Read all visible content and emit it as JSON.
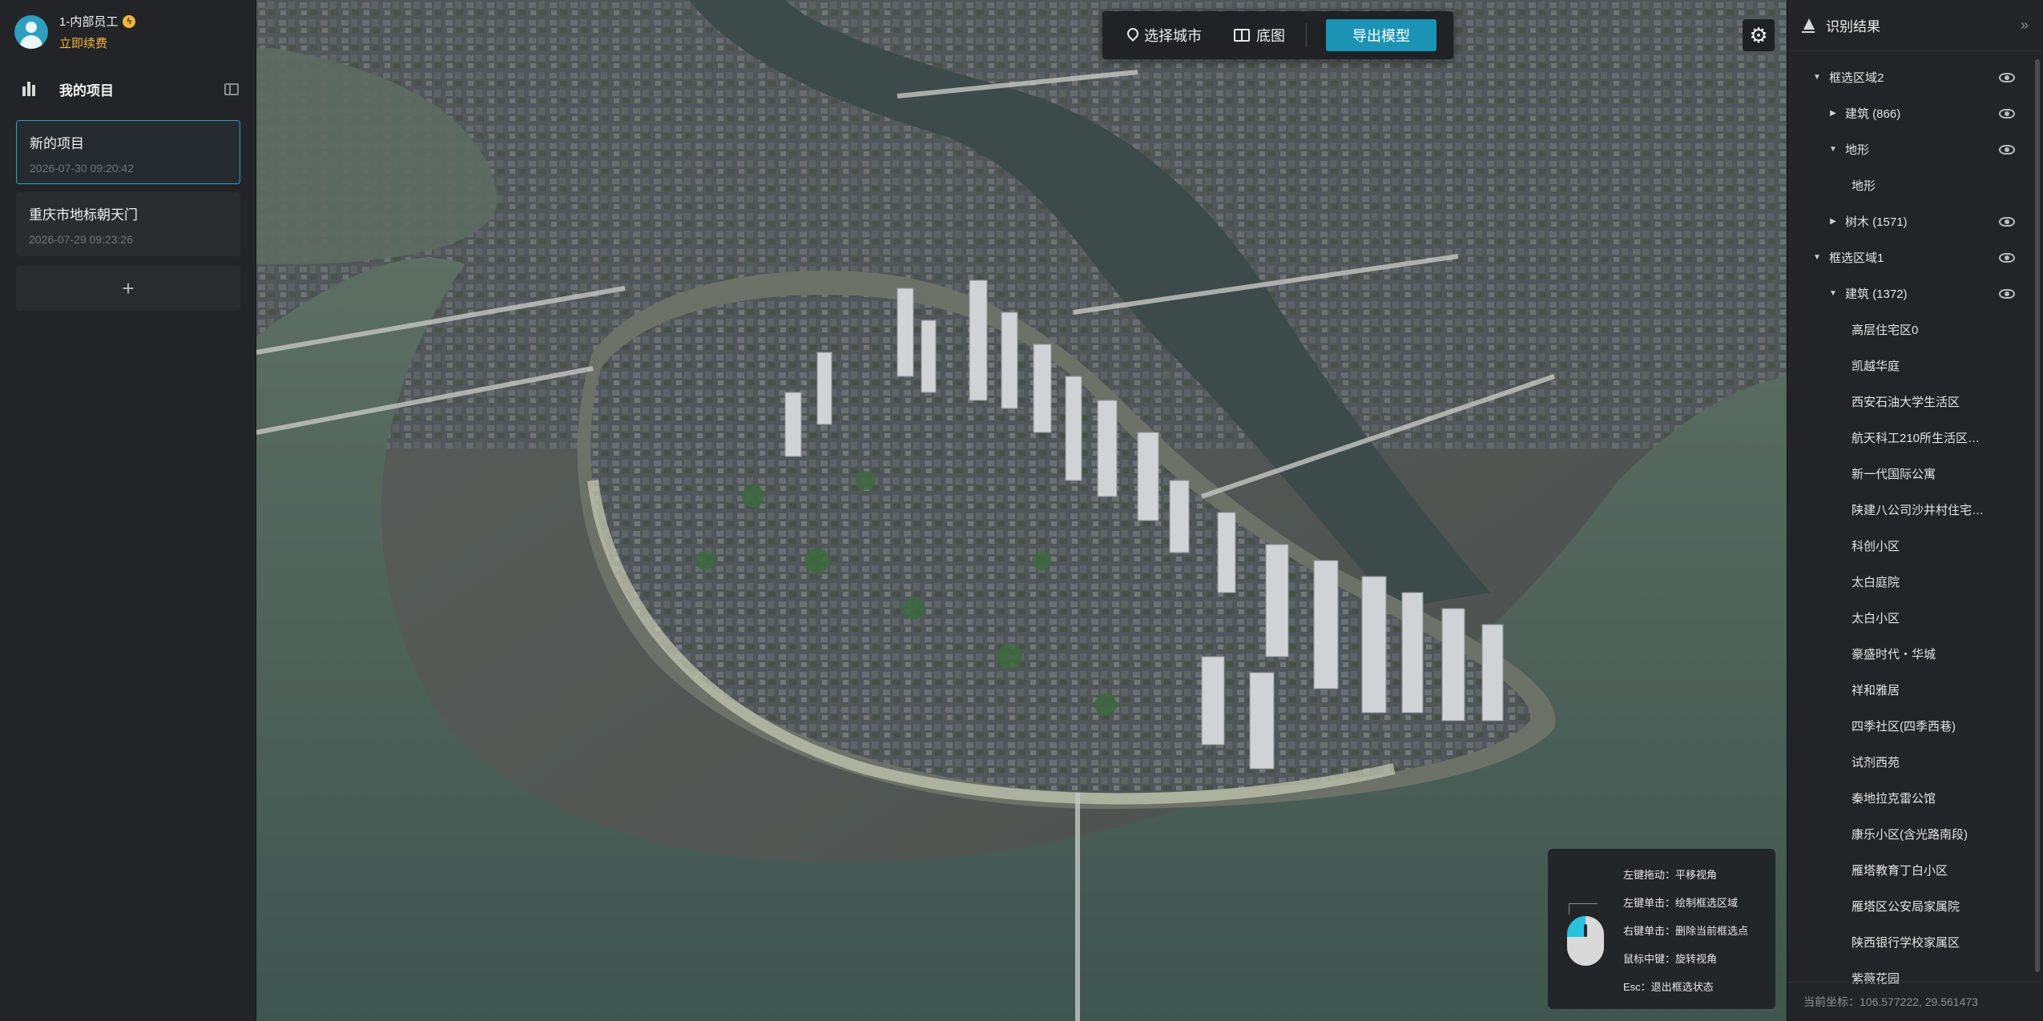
{
  "user": {
    "name": "1-内部员工",
    "renew": "立即续费"
  },
  "projects": {
    "title": "我的项目",
    "items": [
      {
        "name": "新的项目",
        "date": "2026-07-30 09:20:42"
      },
      {
        "name": "重庆市地标朝天门",
        "date": "2026-07-29 09:23:26"
      }
    ],
    "add_label": "+"
  },
  "toolbar": {
    "city_label": "选择城市",
    "basemap_label": "底图",
    "export_label": "导出模型"
  },
  "hints": [
    "左键拖动：平移视角",
    "左键单击：绘制框选区域",
    "右键单击：删除当前框选点",
    "鼠标中键：旋转视角",
    "Esc：退出框选状态"
  ],
  "results": {
    "title": "识别结果",
    "tree": [
      {
        "label": "框选区域2",
        "level": 0,
        "caret": "down",
        "eye": true
      },
      {
        "label": "建筑 (866)",
        "level": 1,
        "caret": "right",
        "eye": true
      },
      {
        "label": "地形",
        "level": 1,
        "caret": "down",
        "eye": true
      },
      {
        "label": "地形",
        "level": 2,
        "caret": "",
        "eye": false
      },
      {
        "label": "树木 (1571)",
        "level": 1,
        "caret": "right",
        "eye": true
      },
      {
        "label": "框选区域1",
        "level": 0,
        "caret": "down",
        "eye": true
      },
      {
        "label": "建筑 (1372)",
        "level": 1,
        "caret": "down",
        "eye": true
      },
      {
        "label": "高层住宅区0",
        "level": 2,
        "caret": "",
        "eye": false
      },
      {
        "label": "凯越华庭",
        "level": 2,
        "caret": "",
        "eye": false
      },
      {
        "label": "西安石油大学生活区",
        "level": 2,
        "caret": "",
        "eye": false
      },
      {
        "label": "航天科工210所生活区…",
        "level": 2,
        "caret": "",
        "eye": false
      },
      {
        "label": "新一代国际公寓",
        "level": 2,
        "caret": "",
        "eye": false
      },
      {
        "label": "陕建八公司沙井村住宅…",
        "level": 2,
        "caret": "",
        "eye": false
      },
      {
        "label": "科创小区",
        "level": 2,
        "caret": "",
        "eye": false
      },
      {
        "label": "太白庭院",
        "level": 2,
        "caret": "",
        "eye": false
      },
      {
        "label": "太白小区",
        "level": 2,
        "caret": "",
        "eye": false
      },
      {
        "label": "豪盛时代・华城",
        "level": 2,
        "caret": "",
        "eye": false
      },
      {
        "label": "祥和雅居",
        "level": 2,
        "caret": "",
        "eye": false
      },
      {
        "label": "四季社区(四季西巷)",
        "level": 2,
        "caret": "",
        "eye": false
      },
      {
        "label": "试剂西苑",
        "level": 2,
        "caret": "",
        "eye": false
      },
      {
        "label": "秦地拉克雷公馆",
        "level": 2,
        "caret": "",
        "eye": false
      },
      {
        "label": "康乐小区(含光路南段)",
        "level": 2,
        "caret": "",
        "eye": false
      },
      {
        "label": "雁塔教育丁白小区",
        "level": 2,
        "caret": "",
        "eye": false
      },
      {
        "label": "雁塔区公安局家属院",
        "level": 2,
        "caret": "",
        "eye": false
      },
      {
        "label": "陕西银行学校家属区",
        "level": 2,
        "caret": "",
        "eye": false
      },
      {
        "label": "紫薇花园",
        "level": 2,
        "caret": "",
        "eye": false
      }
    ]
  },
  "coords": "当前坐标：106.577222, 29.561473",
  "colors": {
    "accent": "#1b93b5",
    "gold": "#f3b53a",
    "panel": "#232427"
  }
}
